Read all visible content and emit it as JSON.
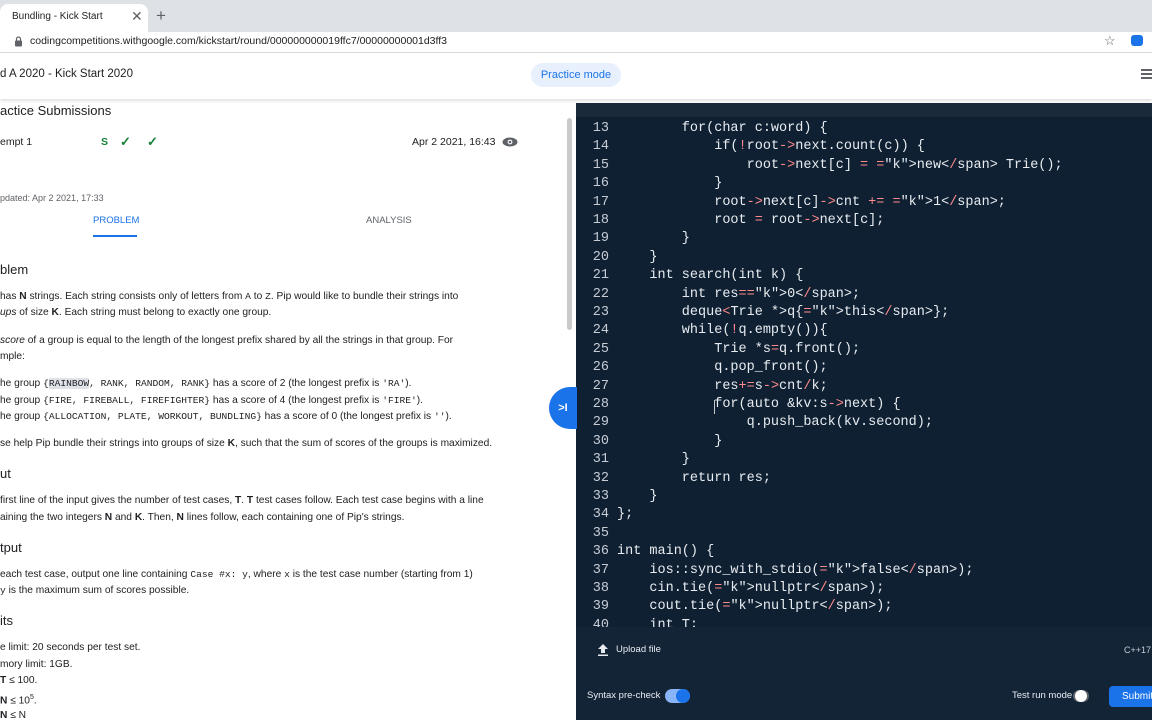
{
  "browser": {
    "tab_title": "Bundling - Kick Start",
    "tab_close": "✕",
    "new_tab": "+",
    "url": "codingcompetitions.withgoogle.com/kickstart/round/000000000019ffc7/00000000001d3ff3",
    "star": "☆"
  },
  "header": {
    "title": "d A 2020 - Kick Start 2020",
    "practice_mode": "Practice mode"
  },
  "submissions": {
    "heading": "actice Submissions",
    "attempt_label": "empt 1",
    "status_s": "S",
    "check1": "✓",
    "check2": "✓",
    "date": "Apr 2 2021, 16:43",
    "updated": "pdated: Apr 2 2021, 17:33"
  },
  "tabs": {
    "problem": "PROBLEM",
    "analysis": "ANALYSIS"
  },
  "problem": {
    "heading": "blem",
    "p1a_pre": "has ",
    "p1a_N": "N",
    "p1a_mid": " strings. Each string consists only of letters from ",
    "p1a_A": "A",
    "p1a_to": " to ",
    "p1a_Z": "Z",
    "p1a_post": ". Pip would like to bundle their strings into",
    "p1b_ups": "ups",
    "p1b_mid": " of size ",
    "p1b_K": "K",
    "p1b_post": ". Each string must belong to exactly one group.",
    "p2a_score": "score",
    "p2a_post": " of a group is equal to the length of the longest prefix shared by all the strings in that group. For",
    "p2b": "mple:",
    "ex1_pre": "he group ",
    "ex1_code_a": "{",
    "ex1_code_hl": "RAINBOW",
    "ex1_code_b": ", RANK, RANDOM, RANK}",
    "ex1_mid": " has a score of 2 (the longest prefix is ",
    "ex1_code_c": "'RA'",
    "ex1_post": ").",
    "ex2_pre": "he group ",
    "ex2_code": "{FIRE, FIREBALL, FIREFIGHTER}",
    "ex2_mid": " has a score of 4 (the longest prefix is ",
    "ex2_code_c": "'FIRE'",
    "ex2_post": ").",
    "ex3_pre": "he group ",
    "ex3_code": "{ALLOCATION, PLATE, WORKOUT, BUNDLING}",
    "ex3_mid": " has a score of 0 (the longest prefix is ",
    "ex3_code_c": "''",
    "ex3_post": ").",
    "p3_pre": "se help Pip bundle their strings into groups of size ",
    "p3_K": "K",
    "p3_post": ", such that the sum of scores of the groups is maximized."
  },
  "input": {
    "heading": "ut",
    "l1_pre": "first line of the input gives the number of test cases, ",
    "l1_T": "T",
    "l1_dot": ". ",
    "l1_T2": "T",
    "l1_post": " test cases follow. Each test case begins with a line",
    "l2_pre": "aining the two integers ",
    "l2_N": "N",
    "l2_and": " and ",
    "l2_K": "K",
    "l2_mid": ". Then, ",
    "l2_N2": "N",
    "l2_post": " lines follow, each containing one of Pip's strings."
  },
  "output": {
    "heading": "tput",
    "l1_pre": "each test case, output one line containing ",
    "l1_code": "Case #x: y",
    "l1_mid": ", where ",
    "l1_x": "x",
    "l1_post": " is the test case number (starting from 1)",
    "l2_y": "y",
    "l2_post": " is the maximum sum of scores possible."
  },
  "limits": {
    "heading": "its",
    "time": "e limit: 20 seconds per test set.",
    "memory": "mory limit: 1GB.",
    "t_T": "T",
    "t_rest": " ≤ 100.",
    "n_N": "N",
    "n_rest": " ≤ 10",
    "n_exp": "5",
    "n_dot": ".",
    "k_N": "N",
    "k_rest": " ≤ N"
  },
  "collapse_label": ">I",
  "editor": {
    "lines": [
      {
        "n": "13",
        "code": "        for(char c:word) {"
      },
      {
        "n": "14",
        "code": "            if(!root->next.count(c)) {"
      },
      {
        "n": "15",
        "code": "                root->next[c] = new Trie();"
      },
      {
        "n": "16",
        "code": "            }"
      },
      {
        "n": "17",
        "code": "            root->next[c]->cnt += 1;"
      },
      {
        "n": "18",
        "code": "            root = root->next[c];"
      },
      {
        "n": "19",
        "code": "        }"
      },
      {
        "n": "20",
        "code": "    }"
      },
      {
        "n": "21",
        "code": "    int search(int k) {"
      },
      {
        "n": "22",
        "code": "        int res=0;"
      },
      {
        "n": "23",
        "code": "        deque<Trie *>q{this};"
      },
      {
        "n": "24",
        "code": "        while(!q.empty()){"
      },
      {
        "n": "25",
        "code": "            Trie *s=q.front();"
      },
      {
        "n": "26",
        "code": "            q.pop_front();"
      },
      {
        "n": "27",
        "code": "            res+=s->cnt/k;"
      },
      {
        "n": "28",
        "code": "            for(auto &kv:s->next) {"
      },
      {
        "n": "29",
        "code": "                q.push_back(kv.second);"
      },
      {
        "n": "30",
        "code": "            }"
      },
      {
        "n": "31",
        "code": "        }"
      },
      {
        "n": "32",
        "code": "        return res;"
      },
      {
        "n": "33",
        "code": "    }"
      },
      {
        "n": "34",
        "code": "};"
      },
      {
        "n": "35",
        "code": ""
      },
      {
        "n": "36",
        "code": "int main() {"
      },
      {
        "n": "37",
        "code": "    ios::sync_with_stdio(false);"
      },
      {
        "n": "38",
        "code": "    cin.tie(nullptr);"
      },
      {
        "n": "39",
        "code": "    cout.tie(nullptr);"
      },
      {
        "n": "40",
        "code": "    int T;"
      }
    ]
  },
  "footer": {
    "upload": "Upload file",
    "language": "C++17",
    "syntax_precheck": "Syntax pre-check",
    "test_run_mode": "Test run mode",
    "submit": "Submit"
  },
  "colors": {
    "accent": "#1a73e8",
    "editor_bg": "#0f2033",
    "keyword": "#ff8b8b",
    "check": "#188038"
  },
  "icons": [
    "google-favicon-icon",
    "close-icon",
    "plus-icon",
    "lock-icon",
    "star-icon",
    "extension-icon",
    "menu-icon",
    "eye-icon",
    "check-icon",
    "collapse-arrow-icon",
    "upload-icon"
  ]
}
